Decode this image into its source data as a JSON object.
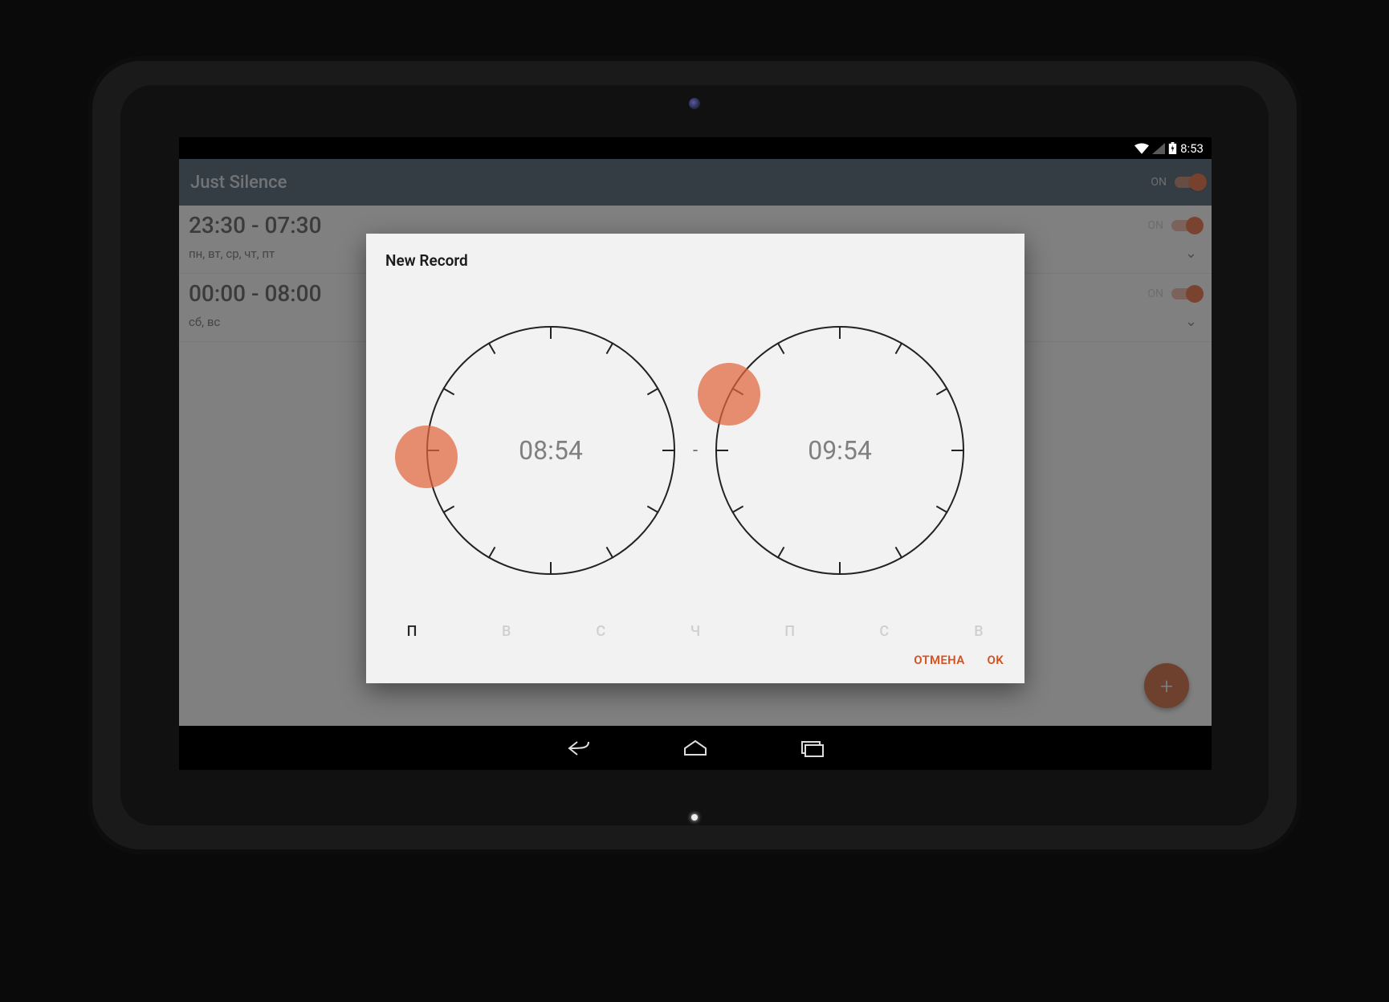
{
  "status": {
    "time": "8:53"
  },
  "appbar": {
    "title": "Just Silence",
    "toggle_label": "ON"
  },
  "rows": [
    {
      "range": "23:30 - 07:30",
      "days": "пн, вт, ср, чт, пт",
      "toggle": "ON"
    },
    {
      "range": "00:00 - 08:00",
      "days": "сб, вс",
      "toggle": "ON"
    }
  ],
  "fab": {
    "glyph": "+"
  },
  "dialog": {
    "title": "New Record",
    "start": {
      "hh": "08",
      "mm": "54",
      "handle_angle_deg": 267
    },
    "end": {
      "hh": "09",
      "mm": "54",
      "handle_angle_deg": 297
    },
    "sep": "-",
    "days": [
      {
        "label": "П",
        "active": true
      },
      {
        "label": "В",
        "active": false
      },
      {
        "label": "С",
        "active": false
      },
      {
        "label": "Ч",
        "active": false
      },
      {
        "label": "П",
        "active": false
      },
      {
        "label": "С",
        "active": false
      },
      {
        "label": "В",
        "active": false
      }
    ],
    "cancel": "ОТМЕНА",
    "ok": "OK"
  },
  "colors": {
    "accent": "#df5420",
    "appbar": "#2c4052"
  }
}
